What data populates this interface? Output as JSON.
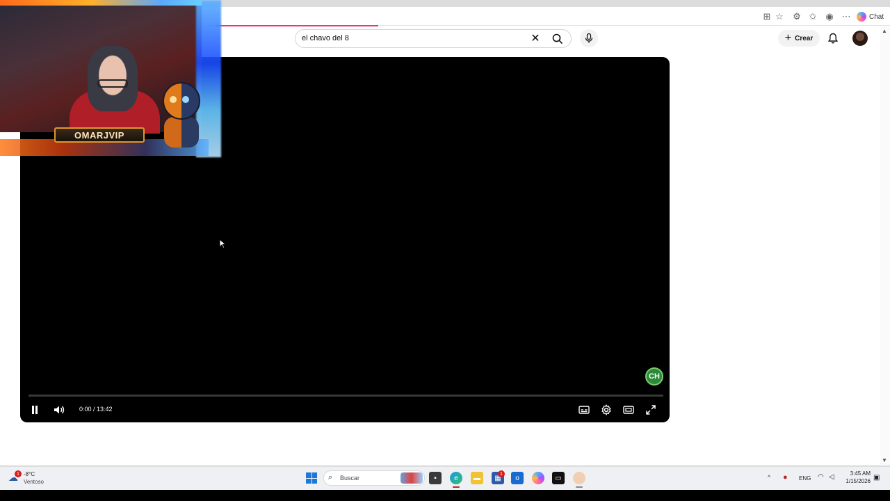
{
  "search": {
    "value": "el chavo del 8",
    "clear_icon": "close-icon",
    "search_icon": "search-icon",
    "mic_icon": "microphone-icon"
  },
  "header": {
    "create_label": "Crear",
    "notifications_icon": "bell-icon",
    "avatar": "account-avatar"
  },
  "browser": {
    "chat_label": "Chat",
    "accent": "#e8396b"
  },
  "player": {
    "current_time": "0:00",
    "duration": "13:42",
    "time_label": "0:00 / 13:42",
    "progress": 0.0,
    "channel_mark": "CH"
  },
  "overlay": {
    "streamer_name": "OMARJVIP"
  },
  "taskbar": {
    "weather": {
      "badge": "1",
      "temp": "-8°C",
      "desc": "Ventoso"
    },
    "search_placeholder": "Buscar",
    "store_badge": "1",
    "language": "ENG",
    "time": "3:45 AM",
    "date": "1/15/2026"
  }
}
